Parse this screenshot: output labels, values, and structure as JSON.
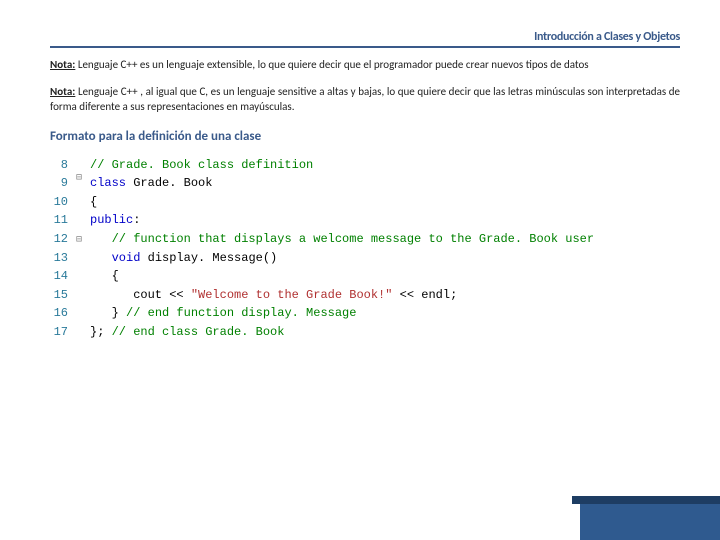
{
  "title": "Introducción a Clases y Objetos",
  "note1": {
    "label": "Nota:",
    "text": " Lenguaje C++ es un lenguaje extensible, lo que quiere decir que el programador puede crear nuevos tipos de datos"
  },
  "note2": {
    "label": "Nota:",
    "text": " Lenguaje C++ , al igual que C, es un lenguaje sensitive a altas y bajas, lo que quiere decir que las letras minúsculas son interpretadas de forma diferente a sus representaciones en mayúsculas."
  },
  "heading": "Formato para la definición de una clase",
  "code": {
    "line_start": 8,
    "lines": [
      {
        "n": 8,
        "fold": "",
        "tokens": [
          [
            "comment",
            "// Grade. Book class definition"
          ]
        ]
      },
      {
        "n": 9,
        "fold": "⊟",
        "tokens": [
          [
            "keyword",
            "class "
          ],
          [
            "plain",
            "Grade. Book"
          ]
        ]
      },
      {
        "n": 10,
        "fold": "",
        "tokens": [
          [
            "plain",
            "{"
          ]
        ]
      },
      {
        "n": 11,
        "fold": "",
        "tokens": [
          [
            "keyword",
            "public"
          ],
          [
            "plain",
            ":"
          ]
        ]
      },
      {
        "n": 12,
        "fold": "",
        "tokens": [
          [
            "plain",
            "   "
          ],
          [
            "comment",
            "// function that displays a welcome message to the Grade. Book user"
          ]
        ]
      },
      {
        "n": 13,
        "fold": "⊟",
        "tokens": [
          [
            "plain",
            "   "
          ],
          [
            "keyword",
            "void "
          ],
          [
            "plain",
            "display. Message()"
          ]
        ]
      },
      {
        "n": 14,
        "fold": "",
        "tokens": [
          [
            "plain",
            "   {"
          ]
        ]
      },
      {
        "n": 15,
        "fold": "",
        "tokens": [
          [
            "plain",
            "      cout << "
          ],
          [
            "string",
            "\"Welcome to the Grade Book!\""
          ],
          [
            "plain",
            " << endl;"
          ]
        ]
      },
      {
        "n": 16,
        "fold": "",
        "tokens": [
          [
            "plain",
            "   } "
          ],
          [
            "comment",
            "// end function display. Message"
          ]
        ]
      },
      {
        "n": 17,
        "fold": "",
        "tokens": [
          [
            "plain",
            "}; "
          ],
          [
            "comment",
            "// end class Grade. Book"
          ]
        ]
      }
    ]
  }
}
